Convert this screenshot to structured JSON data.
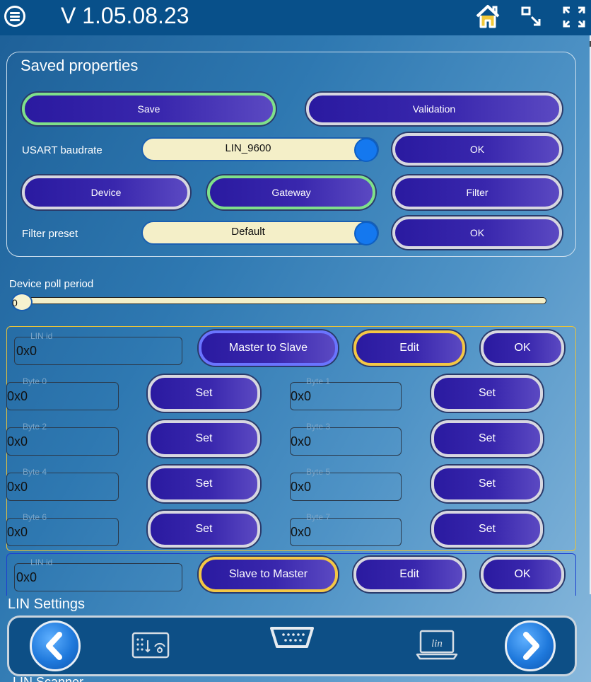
{
  "header": {
    "title": "V 1.05.08.23",
    "icons": [
      "menu-icon",
      "home-icon",
      "minimize-icon",
      "maximize-icon"
    ]
  },
  "saved_properties": {
    "title": "Saved properties",
    "save_label": "Save",
    "validation_label": "Validation",
    "usart_label": "USART baudrate",
    "usart_value": "LIN_9600",
    "ok_label": "OK",
    "device_label": "Device",
    "gateway_label": "Gateway",
    "filter_label": "Filter",
    "filter_preset_label": "Filter preset",
    "filter_preset_value": "Default"
  },
  "poll": {
    "label": "Device poll period",
    "value": "0"
  },
  "frame1": {
    "lin_id_label": "LIN id",
    "lin_id_value": "0x0",
    "direction_label": "Master to Slave",
    "edit_label": "Edit",
    "ok_label": "OK",
    "set_label": "Set",
    "bytes": [
      {
        "label": "Byte 0",
        "value": "0x0"
      },
      {
        "label": "Byte 1",
        "value": "0x0"
      },
      {
        "label": "Byte 2",
        "value": "0x0"
      },
      {
        "label": "Byte 3",
        "value": "0x0"
      },
      {
        "label": "Byte 4",
        "value": "0x0"
      },
      {
        "label": "Byte 5",
        "value": "0x0"
      },
      {
        "label": "Byte 6",
        "value": "0x0"
      },
      {
        "label": "Byte 7",
        "value": "0x0"
      }
    ]
  },
  "frame2": {
    "lin_id_label": "LIN id",
    "lin_id_value": "0x0",
    "direction_label": "Slave to Master",
    "edit_label": "Edit",
    "ok_label": "OK"
  },
  "footer": {
    "section_label": "LIN Settings",
    "next_section_label": "LIN Scanner",
    "nav_icons": [
      "prev-arrow-icon",
      "dashboard-settings-icon",
      "serial-port-icon",
      "lin-laptop-icon",
      "next-arrow-icon"
    ],
    "lin_icon_text": "lin"
  }
}
